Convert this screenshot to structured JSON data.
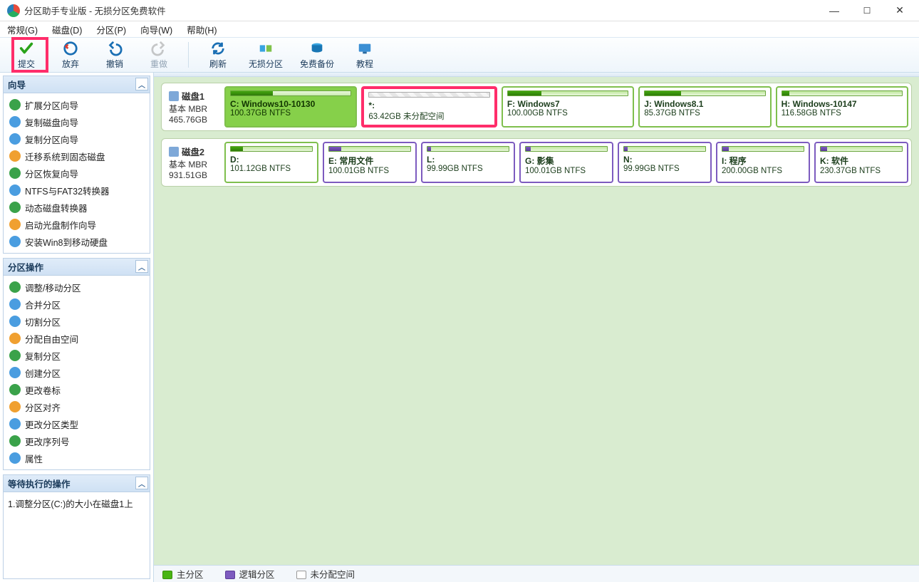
{
  "window": {
    "title": "分区助手专业版 - 无损分区免费软件"
  },
  "menu": [
    "常规(G)",
    "磁盘(D)",
    "分区(P)",
    "向导(W)",
    "帮助(H)"
  ],
  "toolbar": {
    "commit": "提交",
    "discard": "放弃",
    "undo": "撤销",
    "redo": "重做",
    "refresh": "刷新",
    "lossless": "无损分区",
    "backup": "免费备份",
    "tutorial": "教程"
  },
  "sidebar": {
    "wizard_title": "向导",
    "wizard_items": [
      "扩展分区向导",
      "复制磁盘向导",
      "复制分区向导",
      "迁移系统到固态磁盘",
      "分区恢复向导",
      "NTFS与FAT32转换器",
      "动态磁盘转换器",
      "启动光盘制作向导",
      "安装Win8到移动硬盘"
    ],
    "ops_title": "分区操作",
    "ops_items": [
      "调整/移动分区",
      "合并分区",
      "切割分区",
      "分配自由空间",
      "复制分区",
      "创建分区",
      "更改卷标",
      "分区对齐",
      "更改分区类型",
      "更改序列号",
      "属性"
    ],
    "pending_title": "等待执行的操作",
    "pending_items": [
      "1.调整分区(C:)的大小在磁盘1上"
    ]
  },
  "disks": [
    {
      "name": "磁盘1",
      "type": "基本 MBR",
      "size": "465.76GB",
      "partitions": [
        {
          "label": "C: Windows10-10130",
          "sub": "100.37GB NTFS",
          "kind": "primary",
          "selected": true,
          "fill": 35
        },
        {
          "label": "*:",
          "sub": "63.42GB 未分配空间",
          "kind": "unalloc",
          "highlighted": true
        },
        {
          "label": "F: Windows7",
          "sub": "100.00GB NTFS",
          "kind": "primary",
          "fill": 28
        },
        {
          "label": "J: Windows8.1",
          "sub": "85.37GB NTFS",
          "kind": "primary",
          "fill": 30
        },
        {
          "label": "H: Windows-10147",
          "sub": "116.58GB NTFS",
          "kind": "primary",
          "fill": 6
        }
      ]
    },
    {
      "name": "磁盘2",
      "type": "基本 MBR",
      "size": "931.51GB",
      "partitions": [
        {
          "label": "D:",
          "sub": "101.12GB NTFS",
          "kind": "primary",
          "fill": 15
        },
        {
          "label": "E: 常用文件",
          "sub": "100.01GB NTFS",
          "kind": "logical",
          "fill": 15
        },
        {
          "label": "L:",
          "sub": "99.99GB NTFS",
          "kind": "logical",
          "fill": 4
        },
        {
          "label": "G: 影集",
          "sub": "100.01GB NTFS",
          "kind": "logical",
          "fill": 6
        },
        {
          "label": "N:",
          "sub": "99.99GB NTFS",
          "kind": "logical",
          "fill": 4
        },
        {
          "label": "I: 程序",
          "sub": "200.00GB NTFS",
          "kind": "logical",
          "fill": 8
        },
        {
          "label": "K: 软件",
          "sub": "230.37GB NTFS",
          "kind": "logical",
          "fill": 8
        }
      ]
    }
  ],
  "legend": {
    "primary": "主分区",
    "logical": "逻辑分区",
    "unalloc": "未分配空间"
  }
}
